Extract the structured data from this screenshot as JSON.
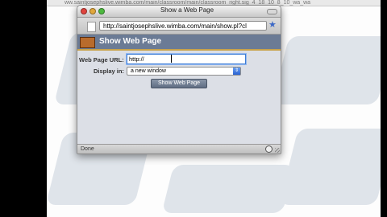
{
  "background_browser": {
    "url_fragment": "ww.saintjosephslive.wimba.com/main/classroom/main/classroom_right.sig_4_18_10_8_10_wa_wa"
  },
  "window": {
    "title": "Show a Web Page",
    "address": "http://saintjosephslive.wimba.com/main/show.pl?cl",
    "status": "Done"
  },
  "banner": {
    "title": "Show Web Page"
  },
  "form": {
    "url_label": "Web Page URL:",
    "url_value": "http://",
    "display_label": "Display in:",
    "display_value": "a new window",
    "submit_label": "Show Web Page"
  },
  "colors": {
    "banner": "#6b7b95",
    "banner_rule": "#c8a24a",
    "focus_ring": "#3c7cd6"
  }
}
